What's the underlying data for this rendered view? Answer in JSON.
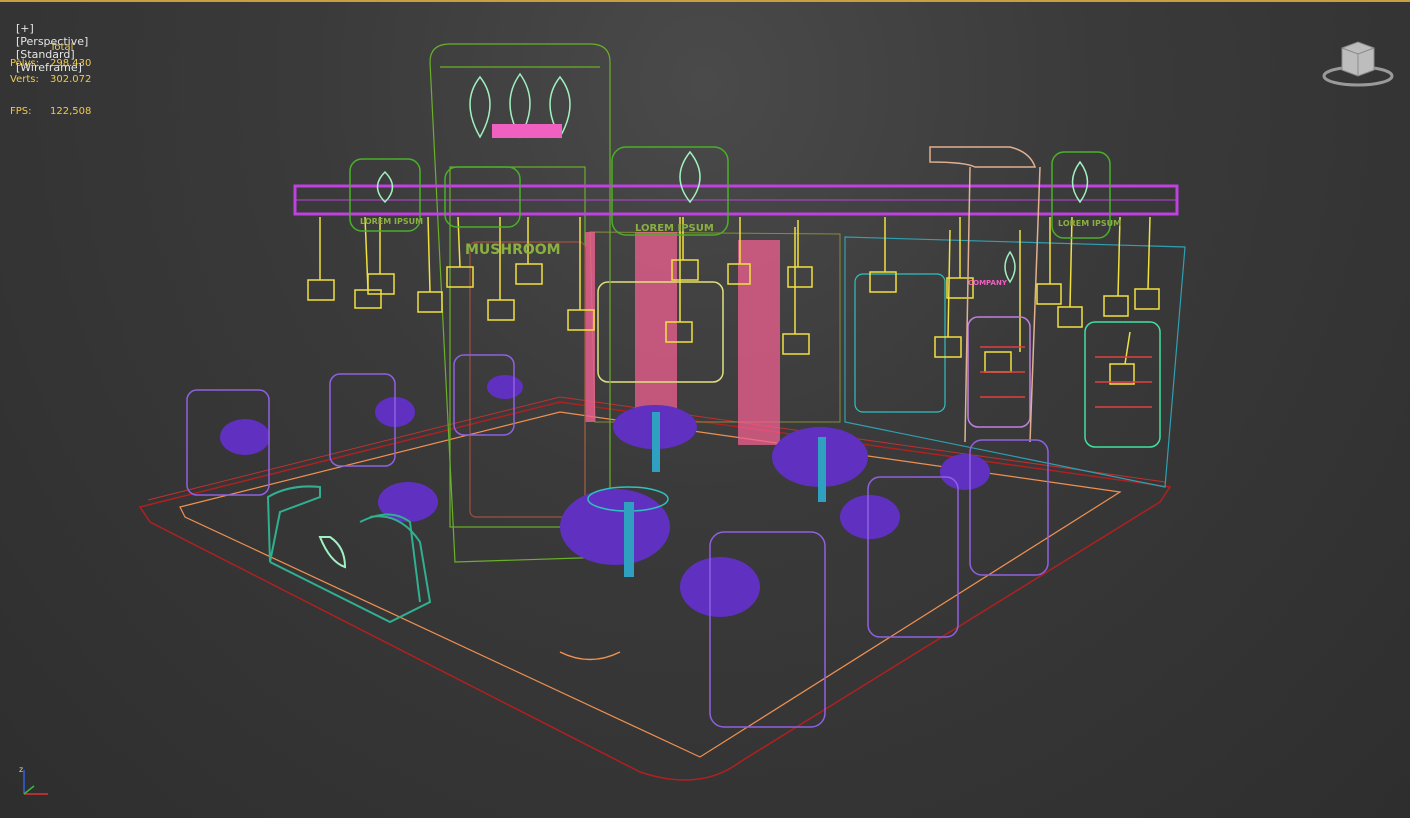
{
  "viewport": {
    "label_parts": [
      "[+]",
      "[Perspective]",
      "[Standard]",
      "[Wireframe]"
    ]
  },
  "stats": {
    "header": "Total",
    "polys_label": "Polys:",
    "polys_value": "298.430",
    "verts_label": "Verts:",
    "verts_value": "302.072",
    "fps_label": "FPS:",
    "fps_value": "122,508"
  },
  "viewcube": {
    "icon": "viewcube-icon"
  },
  "axis": {
    "z": "z",
    "icon": "axis-tripod-icon"
  },
  "colors": {
    "stats_text": "#f0c850",
    "label_text": "#e6e6e6",
    "floor_outline": "#b02020",
    "trim_orange": "#f09050",
    "truss_magenta": "#c040e0",
    "lamp_yellow": "#f0e040",
    "wall_green": "#6ab02a",
    "pink_curtain": "#f06090",
    "furniture_purple": "#6030c0",
    "counter_teal": "#30b090",
    "glass_cyan": "#30c0c0",
    "leaf_mint": "#a0f0c0"
  },
  "scene": {
    "sign_texts": [
      "MUSHROOM",
      "LOREM IPSUM",
      "LOREM IPSUM",
      "LOREM IPSUM",
      "COMPANY"
    ]
  }
}
